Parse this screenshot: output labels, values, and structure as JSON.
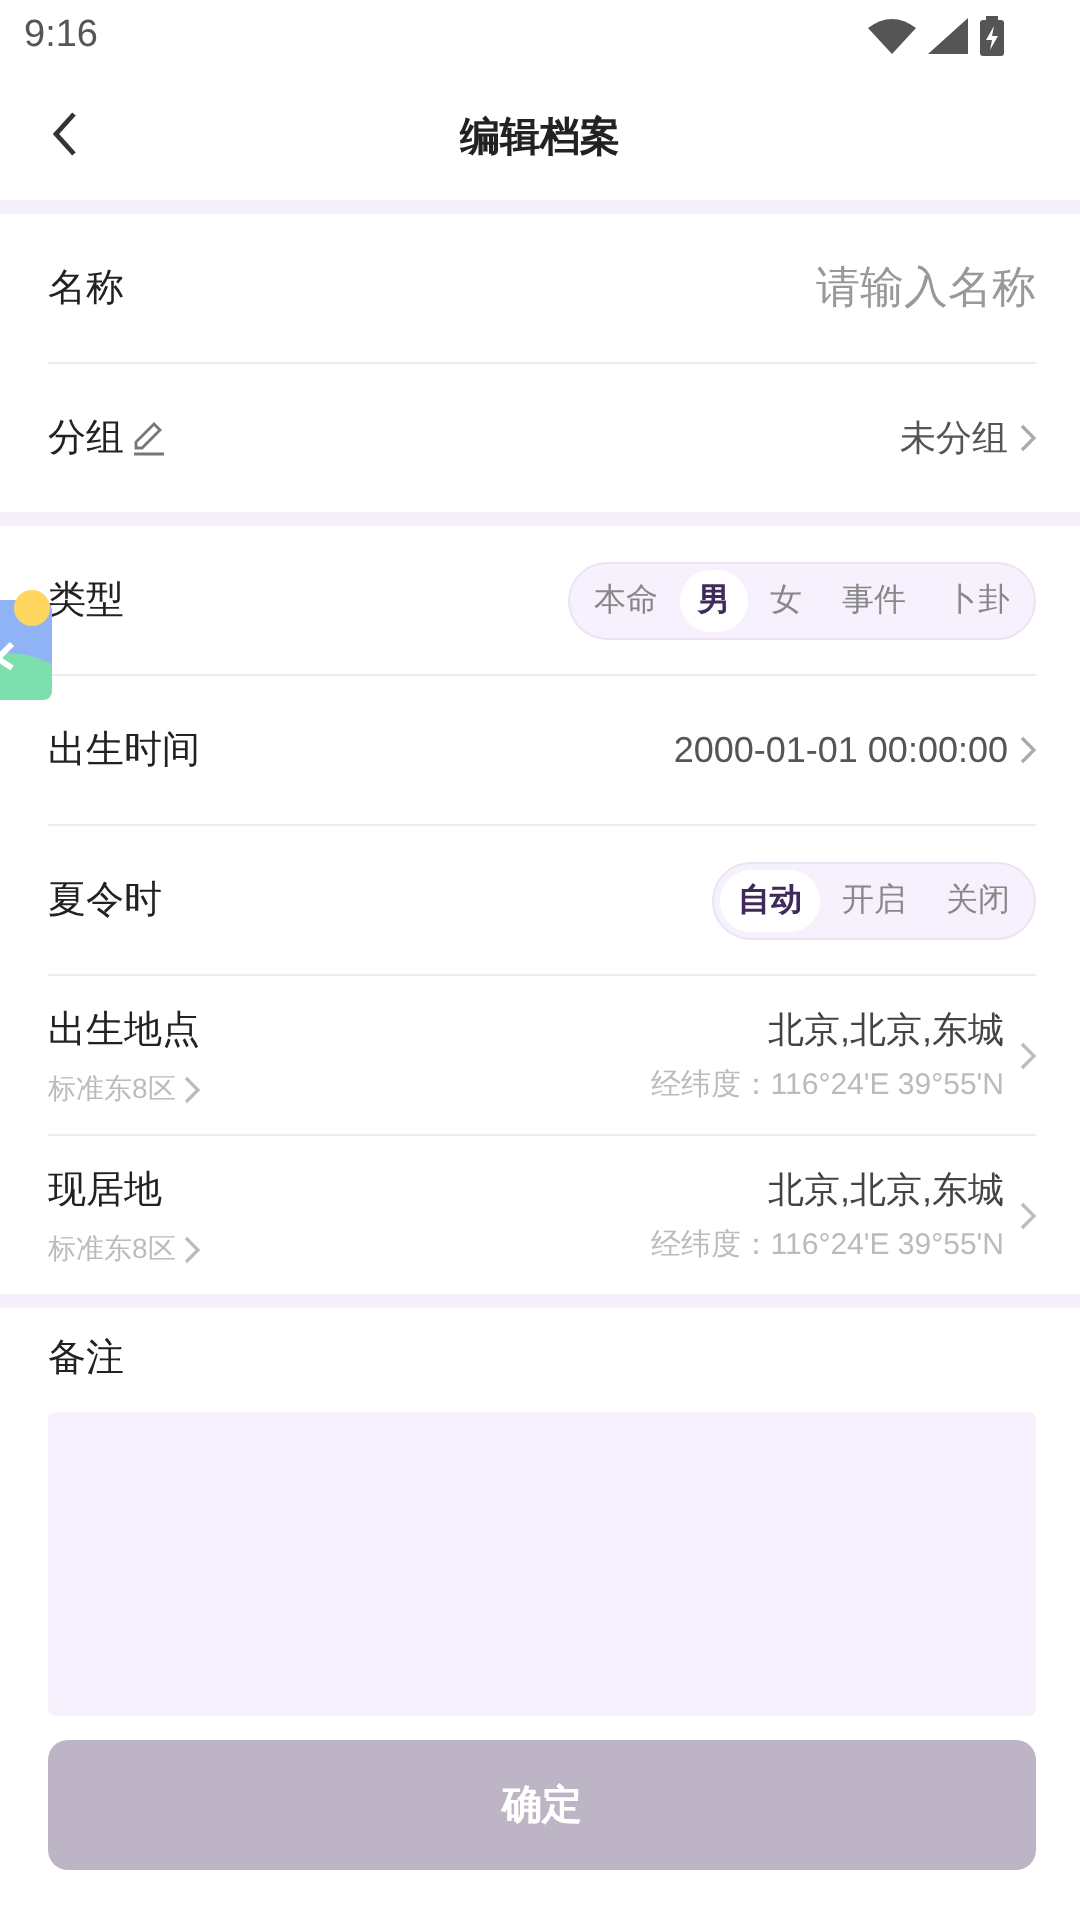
{
  "status_bar": {
    "time": "9:16"
  },
  "header": {
    "title": "编辑档案"
  },
  "sections": [
    {
      "rows": [
        {
          "kind": "input",
          "label": "名称",
          "placeholder": "请输入名称"
        },
        {
          "kind": "picker",
          "label": "分组",
          "editable": true,
          "value": "未分组"
        }
      ]
    },
    {
      "rows": [
        {
          "kind": "segmented",
          "label": "类型",
          "options": [
            {
              "label": "本命",
              "selected": false
            },
            {
              "label": "男",
              "selected": true
            },
            {
              "label": "女",
              "selected": false
            },
            {
              "label": "事件",
              "selected": false
            },
            {
              "label": "卜卦",
              "selected": false
            }
          ]
        },
        {
          "kind": "picker",
          "label": "出生时间",
          "value": "2000-01-01 00:00:00"
        },
        {
          "kind": "segmented",
          "label": "夏令时",
          "options": [
            {
              "label": "自动",
              "selected": true
            },
            {
              "label": "开启",
              "selected": false
            },
            {
              "label": "关闭",
              "selected": false
            }
          ]
        },
        {
          "kind": "place",
          "label": "出生地点",
          "timezone": "标准东8区",
          "value": "北京,北京,东城",
          "coords": "经纬度：116°24'E 39°55'N"
        },
        {
          "kind": "place",
          "label": "现居地",
          "timezone": "标准东8区",
          "value": "北京,北京,东城",
          "coords": "经纬度：116°24'E 39°55'N"
        }
      ]
    }
  ],
  "remarks": {
    "label": "备注"
  },
  "confirm_button": {
    "label": "确定",
    "disabled": true
  }
}
